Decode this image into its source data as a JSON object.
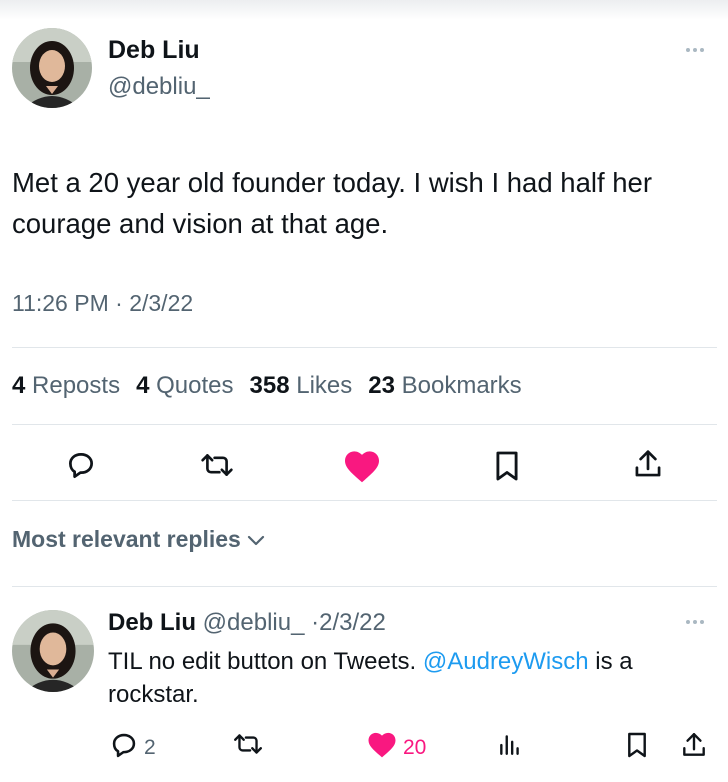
{
  "tweet": {
    "author_name": "Deb Liu",
    "author_handle": "@debliu_",
    "text": "Met a 20 year old founder today. I wish I had half her courage and vision at that age.",
    "time": "11:26 PM",
    "separator": "·",
    "date": "2/3/22",
    "stats": [
      {
        "count": "4",
        "label": "Reposts"
      },
      {
        "count": "4",
        "label": "Quotes"
      },
      {
        "count": "358",
        "label": "Likes"
      },
      {
        "count": "23",
        "label": "Bookmarks"
      }
    ],
    "actions": [
      "reply-icon",
      "repost-icon",
      "like-icon",
      "bookmark-icon",
      "share-icon"
    ],
    "liked": true
  },
  "sort_label": "Most relevant replies",
  "reply": {
    "author_name": "Deb Liu",
    "author_handle": "@debliu_",
    "separator": "·",
    "date": "2/3/22",
    "text_before": "TIL no edit button on Tweets. ",
    "mention": "@AudreyWisch",
    "text_after": " is a rockstar.",
    "reply_count": "2",
    "like_count": "20"
  },
  "colors": {
    "text": "#0f1419",
    "secondary": "#536471",
    "like": "#f91880",
    "link": "#1d9bf0",
    "divider": "#e1e6ea"
  }
}
